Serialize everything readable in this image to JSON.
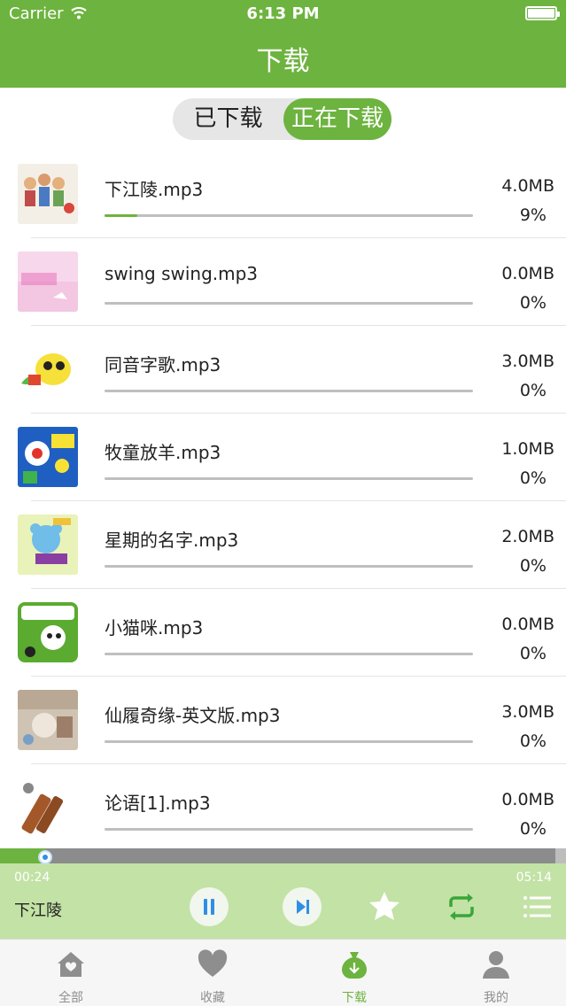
{
  "status_bar": {
    "carrier": "Carrier",
    "time": "6:13 PM"
  },
  "nav": {
    "title": "下载"
  },
  "segment": {
    "downloaded": "已下载",
    "downloading": "正在下载",
    "selected": "downloading"
  },
  "downloads": [
    {
      "name": "下江陵.mp3",
      "size": "4.0MB",
      "percent": "9%",
      "progress": 0.09
    },
    {
      "name": "swing swing.mp3",
      "size": "0.0MB",
      "percent": "0%",
      "progress": 0
    },
    {
      "name": "同音字歌.mp3",
      "size": "3.0MB",
      "percent": "0%",
      "progress": 0
    },
    {
      "name": "牧童放羊.mp3",
      "size": "1.0MB",
      "percent": "0%",
      "progress": 0
    },
    {
      "name": "星期的名字.mp3",
      "size": "2.0MB",
      "percent": "0%",
      "progress": 0
    },
    {
      "name": "小猫咪.mp3",
      "size": "0.0MB",
      "percent": "0%",
      "progress": 0
    },
    {
      "name": "仙履奇缘-英文版.mp3",
      "size": "3.0MB",
      "percent": "0%",
      "progress": 0
    },
    {
      "name": "论语[1].mp3",
      "size": "0.0MB",
      "percent": "0%",
      "progress": 0
    }
  ],
  "player": {
    "current_time": "00:24",
    "total_time": "05:14",
    "title": "下江陵",
    "progress": 0.08,
    "icons": [
      "pause-icon",
      "next-icon",
      "star-icon",
      "repeat-icon",
      "playlist-icon"
    ]
  },
  "tabs": [
    {
      "label": "全部",
      "icon": "home-icon",
      "active": false
    },
    {
      "label": "收藏",
      "icon": "heart-icon",
      "active": false
    },
    {
      "label": "下载",
      "icon": "download-icon",
      "active": true
    },
    {
      "label": "我的",
      "icon": "user-icon",
      "active": false
    }
  ],
  "colors": {
    "accent": "#6db33f",
    "player_bg": "#c3e2a5",
    "track": "#bfbfbf"
  }
}
